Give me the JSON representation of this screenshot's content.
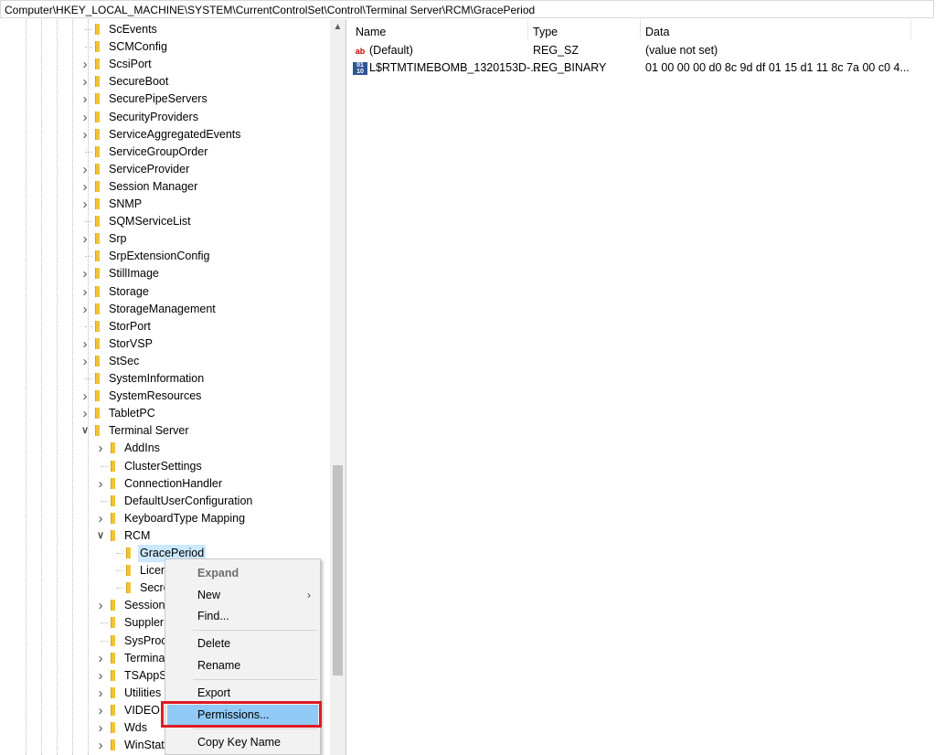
{
  "address_bar": "Computer\\HKEY_LOCAL_MACHINE\\SYSTEM\\CurrentControlSet\\Control\\Terminal Server\\RCM\\GracePeriod",
  "tree": {
    "items": [
      {
        "label": "ScEvents",
        "expandable": false
      },
      {
        "label": "SCMConfig",
        "expandable": false
      },
      {
        "label": "ScsiPort",
        "expandable": true
      },
      {
        "label": "SecureBoot",
        "expandable": true
      },
      {
        "label": "SecurePipeServers",
        "expandable": true
      },
      {
        "label": "SecurityProviders",
        "expandable": true
      },
      {
        "label": "ServiceAggregatedEvents",
        "expandable": true
      },
      {
        "label": "ServiceGroupOrder",
        "expandable": false
      },
      {
        "label": "ServiceProvider",
        "expandable": true
      },
      {
        "label": "Session Manager",
        "expandable": true
      },
      {
        "label": "SNMP",
        "expandable": true
      },
      {
        "label": "SQMServiceList",
        "expandable": false
      },
      {
        "label": "Srp",
        "expandable": true
      },
      {
        "label": "SrpExtensionConfig",
        "expandable": false
      },
      {
        "label": "StillImage",
        "expandable": true
      },
      {
        "label": "Storage",
        "expandable": true
      },
      {
        "label": "StorageManagement",
        "expandable": true
      },
      {
        "label": "StorPort",
        "expandable": false
      },
      {
        "label": "StorVSP",
        "expandable": true
      },
      {
        "label": "StSec",
        "expandable": true
      },
      {
        "label": "SystemInformation",
        "expandable": false
      },
      {
        "label": "SystemResources",
        "expandable": true
      },
      {
        "label": "TabletPC",
        "expandable": true
      },
      {
        "label": "Terminal Server",
        "expandable": true,
        "expanded": true
      },
      {
        "label": "AddIns",
        "expandable": true
      },
      {
        "label": "ClusterSettings",
        "expandable": false
      },
      {
        "label": "ConnectionHandler",
        "expandable": true
      },
      {
        "label": "DefaultUserConfiguration",
        "expandable": false
      },
      {
        "label": "KeyboardType Mapping",
        "expandable": true
      },
      {
        "label": "RCM",
        "expandable": true,
        "expanded": true
      },
      {
        "label": "GracePeriod",
        "expandable": false,
        "selected": true
      },
      {
        "label": "Licen",
        "expandable": false
      },
      {
        "label": "Secre",
        "expandable": false
      },
      {
        "label": "Session",
        "expandable": true
      },
      {
        "label": "Suppler",
        "expandable": false
      },
      {
        "label": "SysProc",
        "expandable": false
      },
      {
        "label": "Termina",
        "expandable": true
      },
      {
        "label": "TSAppS",
        "expandable": true
      },
      {
        "label": "Utilities",
        "expandable": true
      },
      {
        "label": "VIDEO",
        "expandable": true
      },
      {
        "label": "Wds",
        "expandable": true
      },
      {
        "label": "WinStat",
        "expandable": true
      }
    ]
  },
  "values_pane": {
    "columns": {
      "name": "Name",
      "type": "Type",
      "data": "Data"
    },
    "rows": [
      {
        "icon": "string-value-icon",
        "name": "(Default)",
        "type": "REG_SZ",
        "data": "(value not set)"
      },
      {
        "icon": "binary-value-icon",
        "name": "L$RTMTIMEBOMB_1320153D-...",
        "type": "REG_BINARY",
        "data": "01 00 00 00 d0 8c 9d df 01 15 d1 11 8c 7a 00 c0 4..."
      }
    ]
  },
  "context_menu": {
    "expand": "Expand",
    "new": "New",
    "find": "Find...",
    "delete": "Delete",
    "rename": "Rename",
    "export": "Export",
    "permissions": "Permissions...",
    "copy_key_name": "Copy Key Name",
    "highlight_color": "#91c9f7",
    "annotation_color": "#e01b24"
  }
}
